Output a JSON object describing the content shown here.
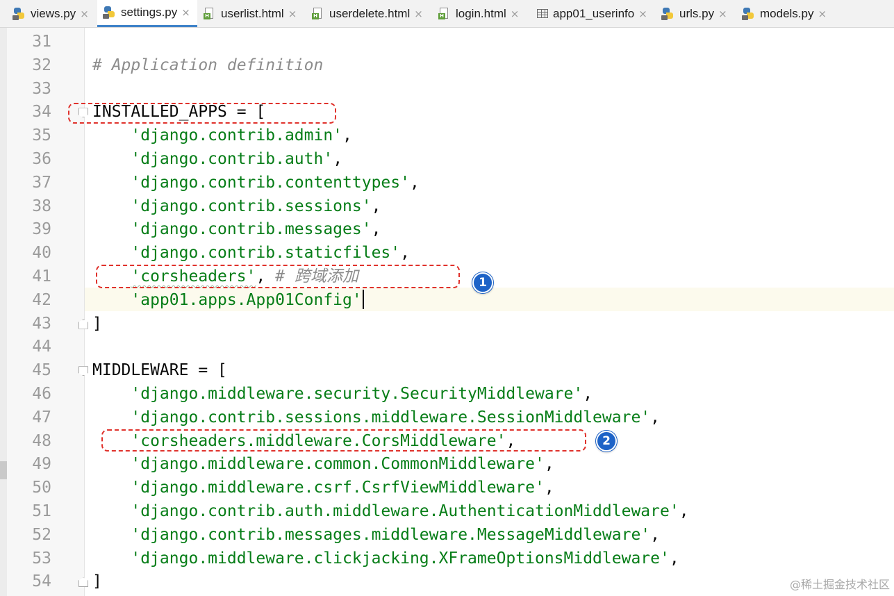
{
  "tabs": [
    {
      "label": "views.py",
      "icon": "python-file-icon",
      "active": false
    },
    {
      "label": "settings.py",
      "icon": "python-file-icon",
      "active": true
    },
    {
      "label": "userlist.html",
      "icon": "html-file-icon",
      "active": false
    },
    {
      "label": "userdelete.html",
      "icon": "html-file-icon",
      "active": false
    },
    {
      "label": "login.html",
      "icon": "html-file-icon",
      "active": false
    },
    {
      "label": "app01_userinfo",
      "icon": "database-table-icon",
      "active": false
    },
    {
      "label": "urls.py",
      "icon": "python-file-icon",
      "active": false
    },
    {
      "label": "models.py",
      "icon": "python-file-icon",
      "active": false
    }
  ],
  "tab_close_glyph": "×",
  "editor": {
    "current_line": 42,
    "lines": [
      {
        "n": "31",
        "segments": []
      },
      {
        "n": "32",
        "segments": [
          {
            "t": "# Application definition",
            "c": "cmt"
          }
        ]
      },
      {
        "n": "33",
        "segments": []
      },
      {
        "n": "34",
        "segments": [
          {
            "t": "INSTALLED_APPS = [",
            "c": "plain"
          }
        ]
      },
      {
        "n": "35",
        "segments": [
          {
            "t": "    ",
            "c": "plain"
          },
          {
            "t": "'django.contrib.admin'",
            "c": "str"
          },
          {
            "t": ",",
            "c": "plain"
          }
        ]
      },
      {
        "n": "36",
        "segments": [
          {
            "t": "    ",
            "c": "plain"
          },
          {
            "t": "'django.contrib.auth'",
            "c": "str"
          },
          {
            "t": ",",
            "c": "plain"
          }
        ]
      },
      {
        "n": "37",
        "segments": [
          {
            "t": "    ",
            "c": "plain"
          },
          {
            "t": "'django.contrib.contenttypes'",
            "c": "str"
          },
          {
            "t": ",",
            "c": "plain"
          }
        ]
      },
      {
        "n": "38",
        "segments": [
          {
            "t": "    ",
            "c": "plain"
          },
          {
            "t": "'django.contrib.sessions'",
            "c": "str"
          },
          {
            "t": ",",
            "c": "plain"
          }
        ]
      },
      {
        "n": "39",
        "segments": [
          {
            "t": "    ",
            "c": "plain"
          },
          {
            "t": "'django.contrib.messages'",
            "c": "str"
          },
          {
            "t": ",",
            "c": "plain"
          }
        ]
      },
      {
        "n": "40",
        "segments": [
          {
            "t": "    ",
            "c": "plain"
          },
          {
            "t": "'django.contrib.staticfiles'",
            "c": "str"
          },
          {
            "t": ",",
            "c": "plain"
          }
        ]
      },
      {
        "n": "41",
        "segments": [
          {
            "t": "    ",
            "c": "plain"
          },
          {
            "t": "'corsheaders'",
            "c": "str squiggle"
          },
          {
            "t": ", ",
            "c": "plain"
          },
          {
            "t": "# ",
            "c": "cmt"
          },
          {
            "t": "跨域添加",
            "c": "cmt cmt-cn"
          }
        ]
      },
      {
        "n": "42",
        "segments": [
          {
            "t": "    ",
            "c": "plain"
          },
          {
            "t": "'app01.apps.App01Config'",
            "c": "str"
          },
          {
            "t": "",
            "c": "caret"
          }
        ]
      },
      {
        "n": "43",
        "segments": [
          {
            "t": "]",
            "c": "plain"
          }
        ]
      },
      {
        "n": "44",
        "segments": []
      },
      {
        "n": "45",
        "segments": [
          {
            "t": "MIDDLEWARE = [",
            "c": "plain"
          }
        ]
      },
      {
        "n": "46",
        "segments": [
          {
            "t": "    ",
            "c": "plain"
          },
          {
            "t": "'django.middleware.security.SecurityMiddleware'",
            "c": "str"
          },
          {
            "t": ",",
            "c": "plain"
          }
        ]
      },
      {
        "n": "47",
        "segments": [
          {
            "t": "    ",
            "c": "plain"
          },
          {
            "t": "'django.contrib.sessions.middleware.SessionMiddleware'",
            "c": "str"
          },
          {
            "t": ",",
            "c": "plain"
          }
        ]
      },
      {
        "n": "48",
        "segments": [
          {
            "t": "    ",
            "c": "plain"
          },
          {
            "t": "'corsheaders.middleware.CorsMiddleware'",
            "c": "str"
          },
          {
            "t": ",",
            "c": "plain"
          }
        ]
      },
      {
        "n": "49",
        "segments": [
          {
            "t": "    ",
            "c": "plain"
          },
          {
            "t": "'django.middleware.common.CommonMiddleware'",
            "c": "str"
          },
          {
            "t": ",",
            "c": "plain"
          }
        ]
      },
      {
        "n": "50",
        "segments": [
          {
            "t": "    ",
            "c": "plain"
          },
          {
            "t": "'django.middleware.csrf.CsrfViewMiddleware'",
            "c": "str"
          },
          {
            "t": ",",
            "c": "plain"
          }
        ]
      },
      {
        "n": "51",
        "segments": [
          {
            "t": "    ",
            "c": "plain"
          },
          {
            "t": "'django.contrib.auth.middleware.AuthenticationMiddleware'",
            "c": "str"
          },
          {
            "t": ",",
            "c": "plain"
          }
        ]
      },
      {
        "n": "52",
        "segments": [
          {
            "t": "    ",
            "c": "plain"
          },
          {
            "t": "'django.contrib.messages.middleware.MessageMiddleware'",
            "c": "str"
          },
          {
            "t": ",",
            "c": "plain"
          }
        ]
      },
      {
        "n": "53",
        "segments": [
          {
            "t": "    ",
            "c": "plain"
          },
          {
            "t": "'django.middleware.clickjacking.XFrameOptionsMiddleware'",
            "c": "str"
          },
          {
            "t": ",",
            "c": "plain"
          }
        ]
      },
      {
        "n": "54",
        "segments": [
          {
            "t": "]",
            "c": "plain"
          }
        ]
      }
    ],
    "fold_markers": [
      {
        "line": 34,
        "kind": "open"
      },
      {
        "line": 43,
        "kind": "close"
      },
      {
        "line": 45,
        "kind": "open"
      },
      {
        "line": 54,
        "kind": "close"
      }
    ]
  },
  "annotations": [
    {
      "label": "1",
      "line": 41,
      "target": "corsheaders-app-entry"
    },
    {
      "label": "2",
      "line": 48,
      "target": "cors-middleware-entry"
    }
  ],
  "colors": {
    "string": "#067d17",
    "comment": "#8c8c8c",
    "annotation_box": "#e0322c",
    "badge": "#1e63c7",
    "tab_underline": "#4083c9"
  },
  "watermark": "@稀土掘金技术社区"
}
